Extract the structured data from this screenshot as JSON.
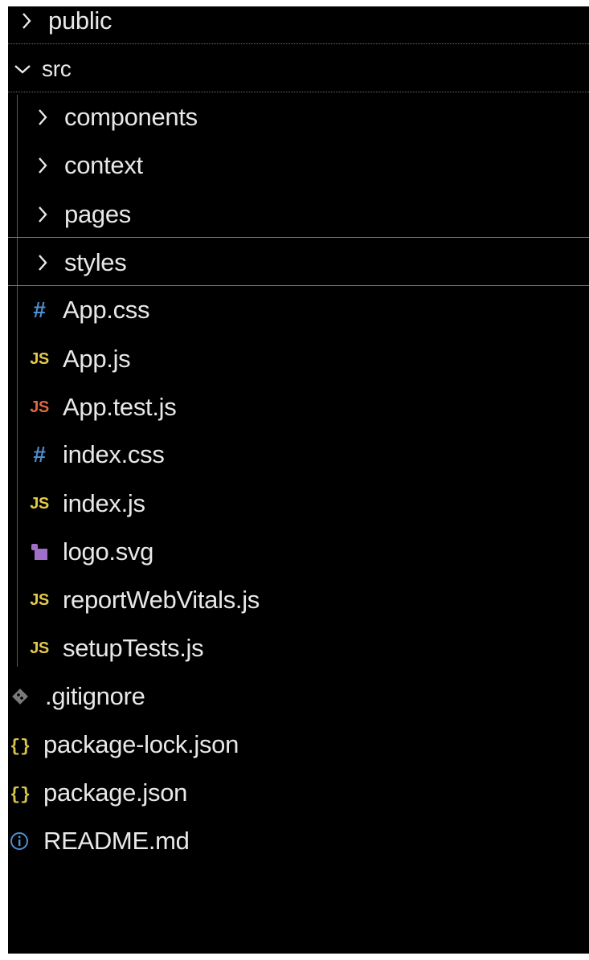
{
  "explorer": {
    "folders": {
      "public": "public",
      "src": "src",
      "components": "components",
      "context": "context",
      "pages": "pages",
      "styles": "styles"
    },
    "files": {
      "app_css": "App.css",
      "app_js": "App.js",
      "app_test_js": "App.test.js",
      "index_css": "index.css",
      "index_js": "index.js",
      "logo_svg": "logo.svg",
      "report_web_vitals_js": "reportWebVitals.js",
      "setup_tests_js": "setupTests.js",
      "gitignore": ".gitignore",
      "package_lock_json": "package-lock.json",
      "package_json": "package.json",
      "readme_md": "README.md"
    },
    "icons": {
      "js_glyph": "JS",
      "css_glyph": "#",
      "json_glyph": "{}",
      "folder_collapsed": "chevron-right-icon",
      "folder_expanded": "chevron-down-icon",
      "svg_file": "image-icon",
      "git_file": "git-icon",
      "info_file": "info-icon"
    },
    "colors": {
      "background": "#000000",
      "text": "#e8e8e8",
      "js_yellow": "#e3c84a",
      "js_test_orange": "#e0663a",
      "css_blue": "#4d8fd1",
      "json_yellow": "#d6c34a",
      "svg_purple": "#a070c8",
      "git_gray": "#7a7a7a",
      "info_blue": "#4d8fd1",
      "focus_border": "#9a6a55"
    }
  }
}
